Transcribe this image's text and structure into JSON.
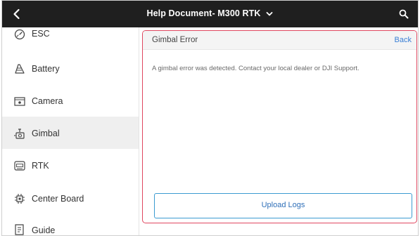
{
  "header": {
    "title": "Help Document- M300 RTK",
    "back_icon": "chevron-left-icon",
    "dropdown_icon": "chevron-down-icon",
    "search_icon": "search-icon"
  },
  "sidebar": {
    "items": [
      {
        "label": "ESC",
        "icon": "gauge-icon",
        "active": false
      },
      {
        "label": "Battery",
        "icon": "battery-icon",
        "active": false
      },
      {
        "label": "Camera",
        "icon": "camera-icon",
        "active": false
      },
      {
        "label": "Gimbal",
        "icon": "gimbal-icon",
        "active": true
      },
      {
        "label": "RTK",
        "icon": "rtk-icon",
        "active": false
      },
      {
        "label": "Center Board",
        "icon": "chip-icon",
        "active": false
      },
      {
        "label": "Guide",
        "icon": "book-icon",
        "active": false
      }
    ]
  },
  "panel": {
    "title": "Gimbal Error",
    "back_label": "Back",
    "message": "A gimbal error was detected. Contact your local dealer or DJI Support.",
    "upload_label": "Upload Logs"
  },
  "colors": {
    "topbar_bg": "#1f1f1f",
    "highlight_border": "#e0475f",
    "link": "#3a7fd5",
    "button_border": "#3b9bd1"
  }
}
